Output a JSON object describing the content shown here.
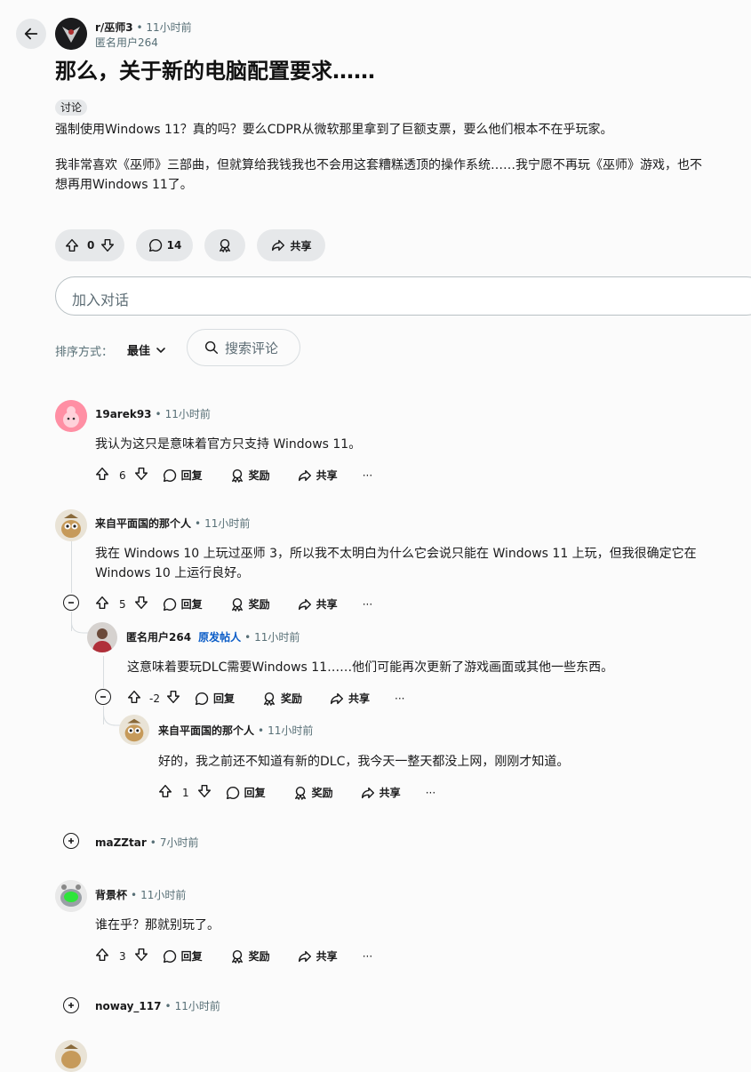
{
  "header": {
    "subreddit": "r/巫师3",
    "time_ago": "11小时前",
    "author": "匿名用户264"
  },
  "post": {
    "title": "那么，关于新的电脑配置要求……",
    "flair": "讨论",
    "paragraph1": "强制使用Windows 11？真的吗？要么CDPR从微软那里拿到了巨额支票，要么他们根本不在乎玩家。",
    "paragraph2_line1": "我非常喜欢《巫师》三部曲，但就算给我钱我也不会用这套糟糕透顶的操作系统……我宁愿不再玩《巫师》游戏，也不",
    "paragraph2_line2": "想再用Windows 11了。",
    "votes": "0",
    "comments": "14",
    "share_label": "共享"
  },
  "comment_input": {
    "placeholder": "加入对话"
  },
  "sort": {
    "label": "排序方式：",
    "value": "最佳"
  },
  "search": {
    "label": "搜索评论"
  },
  "action_labels": {
    "reply": "回复",
    "award": "奖励",
    "share": "共享",
    "more": "···"
  },
  "comments": [
    {
      "user": "19arek93",
      "time": "11小时前",
      "text": "我认为这只是意味着官方只支持 Windows 11。",
      "votes": "6"
    },
    {
      "user": "来自平面国的那个人",
      "time": "11小时前",
      "text_line1": "我在 Windows 10 上玩过巫师 3，所以我不太明白为什么它会说只能在 Windows 11 上玩，但我很确定它在",
      "text_line2": "Windows 10 上运行良好。",
      "votes": "5"
    },
    {
      "user": "匿名用户264",
      "op_badge": "原发帖人",
      "time": "11小时前",
      "text": "这意味着要玩DLC需要Windows 11……他们可能再次更新了游戏画面或其他一些东西。",
      "votes": "-2"
    },
    {
      "user": "来自平面国的那个人",
      "time": "11小时前",
      "text": "好的，我之前还不知道有新的DLC，我今天一整天都没上网，刚刚才知道。",
      "votes": "1"
    },
    {
      "user": "maZZtar",
      "time": "7小时前"
    },
    {
      "user": "背景杯",
      "time": "11小时前",
      "text": "谁在乎？那就别玩了。",
      "votes": "3"
    },
    {
      "user": "noway_117",
      "time": "11小时前"
    }
  ]
}
